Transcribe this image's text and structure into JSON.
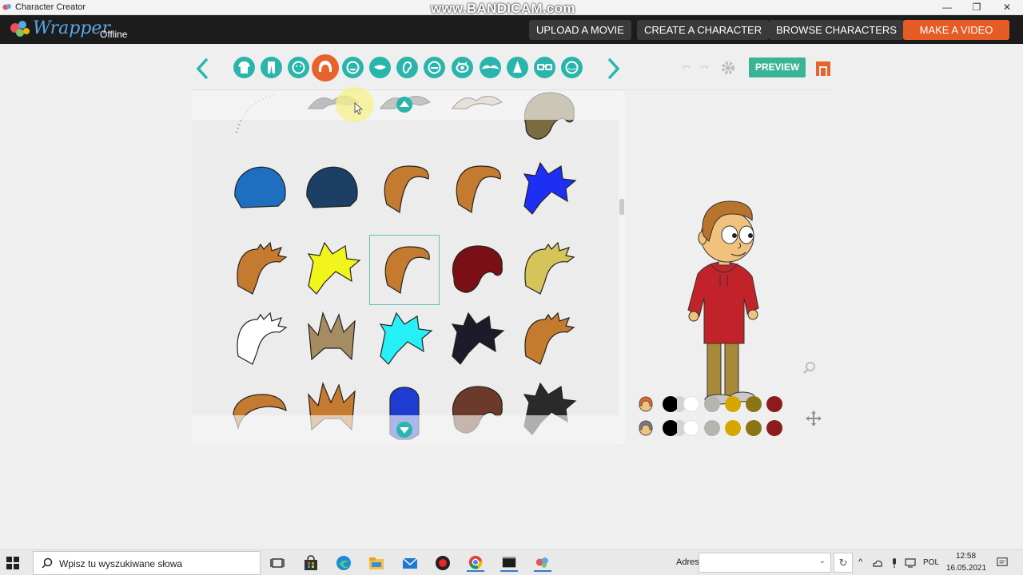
{
  "window": {
    "title": "Character Creator",
    "watermark": "www.BANDICAM.com",
    "controls": {
      "minimize": "—",
      "maximize": "❐",
      "close": "✕"
    }
  },
  "header": {
    "logo_word": "Wrapper",
    "logo_suffix": "Offline",
    "buttons": {
      "upload_movie": "UPLOAD A MOVIE",
      "create_character": "CREATE A CHARACTER",
      "browse_characters": "BROWSE CHARACTERS",
      "make_video": "MAKE A VIDEO"
    },
    "accent_color": "#e65c25"
  },
  "toolbar": {
    "categories": [
      {
        "icon": "shirt-icon"
      },
      {
        "icon": "pants-icon"
      },
      {
        "icon": "face-shape-icon"
      },
      {
        "icon": "hair-icon",
        "active": true
      },
      {
        "icon": "facial-hair-icon"
      },
      {
        "icon": "mouth-icon"
      },
      {
        "icon": "ear-icon"
      },
      {
        "icon": "nose-icon"
      },
      {
        "icon": "eye-icon"
      },
      {
        "icon": "eyebrow-icon"
      },
      {
        "icon": "hat-icon"
      },
      {
        "icon": "glasses-icon"
      },
      {
        "icon": "freckles-icon"
      }
    ],
    "preview_label": "PREVIEW",
    "teal": "#2ab5ac",
    "active_color": "#e8622d"
  },
  "hair_grid": {
    "rows": [
      [
        {
          "name": "sparse-dots-hair",
          "color": "#9a9a9a"
        },
        {
          "name": "small-tuft-hair",
          "color": "#555555"
        },
        {
          "name": "wisp-hair",
          "color": "#666666"
        },
        {
          "name": "bald-top-hair",
          "color": "#c8b49a"
        },
        {
          "name": "curl-tail-hair",
          "color": "#7b6b40"
        }
      ],
      [
        {
          "name": "turban-blue",
          "color": "#1f6fc0"
        },
        {
          "name": "turban-navy",
          "color": "#1c3f66"
        },
        {
          "name": "swoop-brown",
          "color": "#c47a2f"
        },
        {
          "name": "swoop-brown-highlight",
          "color": "#c47a2f"
        },
        {
          "name": "spiky-blue",
          "color": "#1e2ff5"
        }
      ],
      [
        {
          "name": "messy-brown",
          "color": "#c47a2f"
        },
        {
          "name": "spiky-yellow",
          "color": "#f2f51c"
        },
        {
          "name": "swoop-brown-selected",
          "color": "#c47a2f",
          "selected": true
        },
        {
          "name": "curly-red",
          "color": "#7a0f16"
        },
        {
          "name": "wavy-blonde",
          "color": "#d4c45a"
        }
      ],
      [
        {
          "name": "messy-white",
          "color": "#ffffff"
        },
        {
          "name": "spiky-crown",
          "color": "#a58c62"
        },
        {
          "name": "spiky-cyan",
          "color": "#26f0f5"
        },
        {
          "name": "punk-dark",
          "color": "#1b1b2a"
        },
        {
          "name": "bob-brown",
          "color": "#c47a2f"
        }
      ],
      [
        {
          "name": "flat-brown",
          "color": "#c47a2f"
        },
        {
          "name": "tall-crown-brown",
          "color": "#c47a2f"
        },
        {
          "name": "beehive-blue",
          "color": "#1e3cd2"
        },
        {
          "name": "dread-brown",
          "color": "#6b3a2a"
        },
        {
          "name": "spiky-black",
          "color": "#2a2a2a"
        }
      ]
    ]
  },
  "palettes": {
    "row1_icon": "hair-color-icon",
    "row2_icon": "hair-secondary-icon",
    "colors": [
      "#000000",
      "#ffffff",
      "#b5b5ad",
      "#d4a800",
      "#8a7514",
      "#8c1c1c"
    ]
  },
  "taskbar": {
    "search_placeholder": "Wpisz tu wyszukiwane słowa",
    "address_label": "Adres",
    "language": "POL",
    "time": "12:58",
    "date": "16.05.2021"
  }
}
